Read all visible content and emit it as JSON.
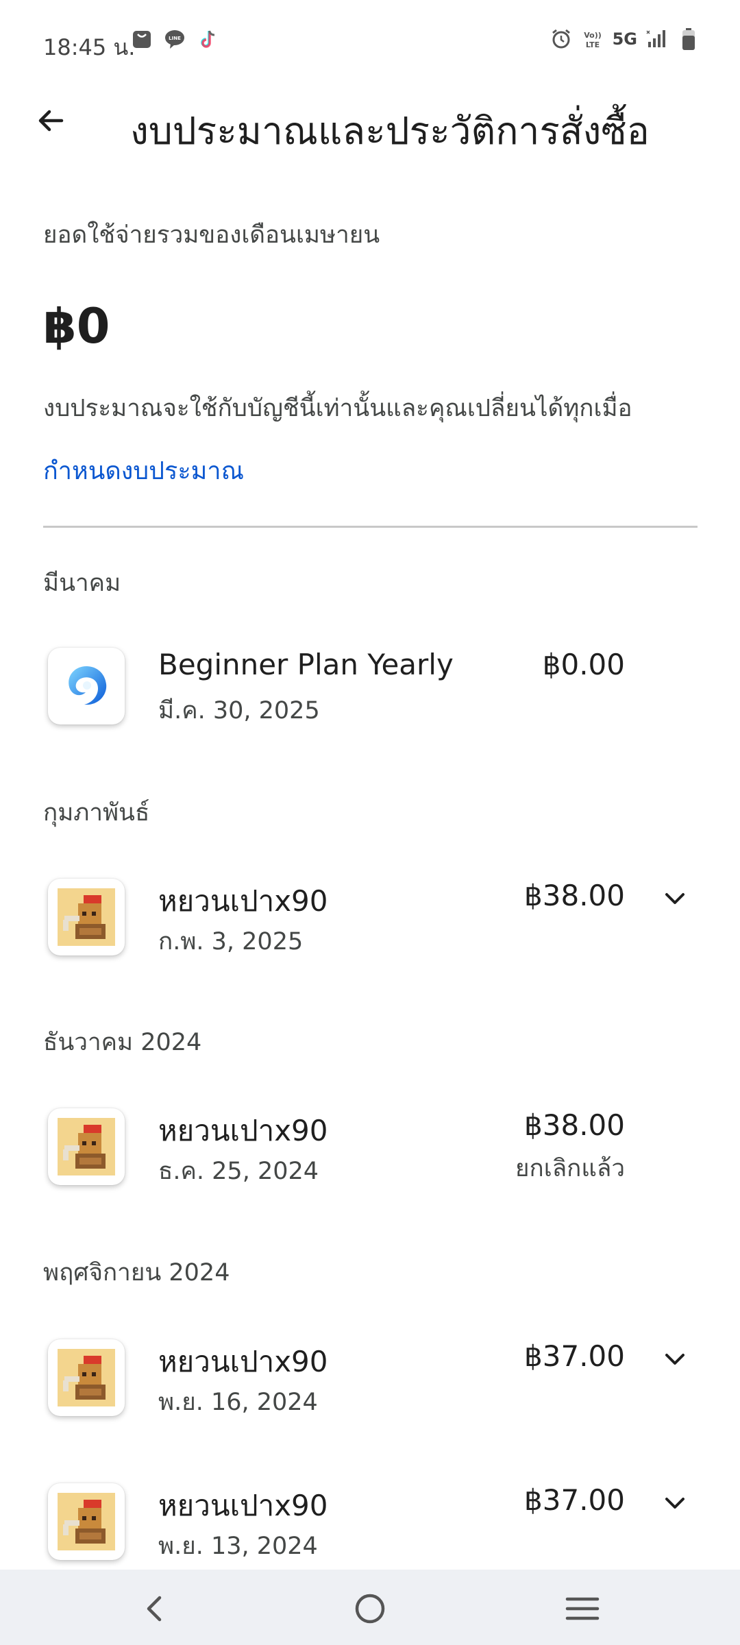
{
  "status_bar": {
    "time": "18:45 น.",
    "network": "5G",
    "left_icons": [
      "shopping-bag-icon",
      "line-icon",
      "tiktok-icon"
    ],
    "right_icons": [
      "alarm-icon",
      "volte-icon",
      "signal-icon",
      "battery-icon"
    ]
  },
  "header": {
    "title": "งบประมาณและประวัติการสั่งซื้อ"
  },
  "summary": {
    "label": "ยอดใช้จ่ายรวมของเดือนเมษายน",
    "amount": "฿0",
    "note": "งบประมาณจะใช้กับบัญชีนี้เท่านั้นและคุณเปลี่ยนได้ทุกเมื่อ",
    "set_budget_link": "กำหนดงบประมาณ"
  },
  "sections": [
    {
      "header": "มีนาคม",
      "items": [
        {
          "name": "Beginner Plan Yearly",
          "date": "มี.ค. 30, 2025",
          "price": "฿0.00",
          "status": "",
          "icon": "swirl-app-icon",
          "expandable": false
        }
      ]
    },
    {
      "header": "กุมภาพันธ์",
      "items": [
        {
          "name": "หยวนเปาx90",
          "date": "ก.พ. 3, 2025",
          "price": "฿38.00",
          "status": "",
          "icon": "pixel-game-icon",
          "expandable": true
        }
      ]
    },
    {
      "header": "ธันวาคม 2024",
      "items": [
        {
          "name": "หยวนเปาx90",
          "date": "ธ.ค. 25, 2024",
          "price": "฿38.00",
          "status": "ยกเลิกแล้ว",
          "icon": "pixel-game-icon",
          "expandable": false
        }
      ]
    },
    {
      "header": "พฤศจิกายน 2024",
      "items": [
        {
          "name": "หยวนเปาx90",
          "date": "พ.ย. 16, 2024",
          "price": "฿37.00",
          "status": "",
          "icon": "pixel-game-icon",
          "expandable": true
        },
        {
          "name": "หยวนเปาx90",
          "date": "พ.ย. 13, 2024",
          "price": "฿37.00",
          "status": "",
          "icon": "pixel-game-icon",
          "expandable": true
        }
      ]
    }
  ],
  "nav_bar": {
    "buttons": [
      "back-nav-icon",
      "home-nav-icon",
      "recents-nav-icon"
    ]
  },
  "colors": {
    "link": "#0b57d0",
    "text_primary": "#1f1f1f",
    "text_secondary": "#444746",
    "divider": "#c8c8c8",
    "nav_bar_bg": "#eef0f4"
  }
}
